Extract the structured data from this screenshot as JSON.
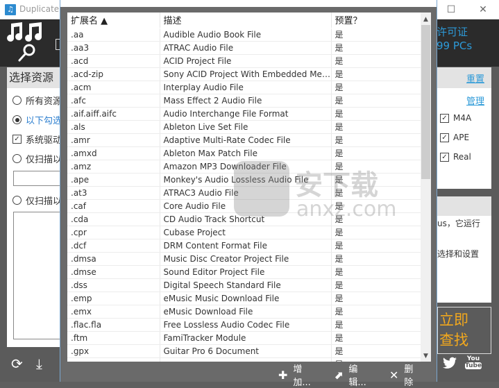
{
  "app": {
    "title": "Duplicate",
    "license_line1": "许可证",
    "license_line2": "99 PCs",
    "left_panel": {
      "heading": "选择资源",
      "options": [
        {
          "label": "所有资源",
          "type": "radio",
          "selected": false
        },
        {
          "label": "以下勾选",
          "type": "radio",
          "selected": true
        },
        {
          "label": "系统驱动",
          "type": "checkbox",
          "checked": true
        },
        {
          "label": "仅扫描以",
          "type": "radio",
          "selected": false
        },
        {
          "label": "仅扫描以",
          "type": "radio",
          "selected": false
        }
      ]
    },
    "right_panel": {
      "reset_link": "重置",
      "manage_link": "管理",
      "formats": [
        {
          "label": "M4A",
          "checked": true
        },
        {
          "label": "APE",
          "checked": true
        },
        {
          "label": "Real",
          "checked": true
        }
      ],
      "info_line1": "us，它运行",
      "info_line2": "选择和设置"
    },
    "start_button": {
      "line1": "立即",
      "line2": "查找"
    },
    "social": {
      "twitter": "twitter-icon",
      "youtube_top": "You",
      "youtube_bottom": "Tube"
    },
    "colors": {
      "accent_blue": "#2d9ad8",
      "start_orange": "#f2a81d",
      "header_dark": "#2b2b2b"
    }
  },
  "dialog": {
    "columns": [
      "扩展名 ▲",
      "描述",
      "预置？"
    ],
    "rows": [
      {
        "ext": ".aa",
        "desc": "Audible Audio Book File",
        "preset": "是"
      },
      {
        "ext": ".aa3",
        "desc": "ATRAC Audio File",
        "preset": "是"
      },
      {
        "ext": ".acd",
        "desc": "ACID Project File",
        "preset": "是"
      },
      {
        "ext": ".acd-zip",
        "desc": "Sony ACID Project With Embedded Media ...",
        "preset": "是"
      },
      {
        "ext": ".acm",
        "desc": "Interplay Audio File",
        "preset": "是"
      },
      {
        "ext": ".afc",
        "desc": "Mass Effect 2 Audio File",
        "preset": "是"
      },
      {
        "ext": ".aif.aiff.aifc",
        "desc": "Audio Interchange File Format",
        "preset": "是"
      },
      {
        "ext": ".als",
        "desc": "Ableton Live Set File",
        "preset": "是"
      },
      {
        "ext": ".amr",
        "desc": "Adaptive Multi-Rate Codec File",
        "preset": "是"
      },
      {
        "ext": ".amxd",
        "desc": "Ableton Max Patch File",
        "preset": "是"
      },
      {
        "ext": ".amz",
        "desc": "Amazon MP3 Downloader File",
        "preset": "是"
      },
      {
        "ext": ".ape",
        "desc": "Monkey's Audio Lossless Audio File",
        "preset": "是"
      },
      {
        "ext": ".at3",
        "desc": "ATRAC3 Audio File",
        "preset": "是"
      },
      {
        "ext": ".caf",
        "desc": "Core Audio File",
        "preset": "是"
      },
      {
        "ext": ".cda",
        "desc": "CD Audio Track Shortcut",
        "preset": "是"
      },
      {
        "ext": ".cpr",
        "desc": "Cubase Project",
        "preset": "是"
      },
      {
        "ext": ".dcf",
        "desc": "DRM Content Format File",
        "preset": "是"
      },
      {
        "ext": ".dmsa",
        "desc": "Music Disc Creator Project File",
        "preset": "是"
      },
      {
        "ext": ".dmse",
        "desc": "Sound Editor Project File",
        "preset": "是"
      },
      {
        "ext": ".dss",
        "desc": "Digital Speech Standard File",
        "preset": "是"
      },
      {
        "ext": ".emp",
        "desc": "eMusic Music Download File",
        "preset": "是"
      },
      {
        "ext": ".emx",
        "desc": "eMusic Download File",
        "preset": "是"
      },
      {
        "ext": ".flac.fla",
        "desc": "Free Lossless Audio Codec File",
        "preset": "是"
      },
      {
        "ext": ".ftm",
        "desc": "FamiTracker Module",
        "preset": "是"
      },
      {
        "ext": ".gpx",
        "desc": "Guitar Pro 6 Document",
        "preset": "是"
      },
      {
        "ext": "",
        "desc": "",
        "preset": "是"
      }
    ],
    "actions": {
      "add": "增加...",
      "edit": "编辑...",
      "delete": "删除"
    }
  },
  "watermark": {
    "cn": "安下载",
    "en": "anxz.com"
  }
}
